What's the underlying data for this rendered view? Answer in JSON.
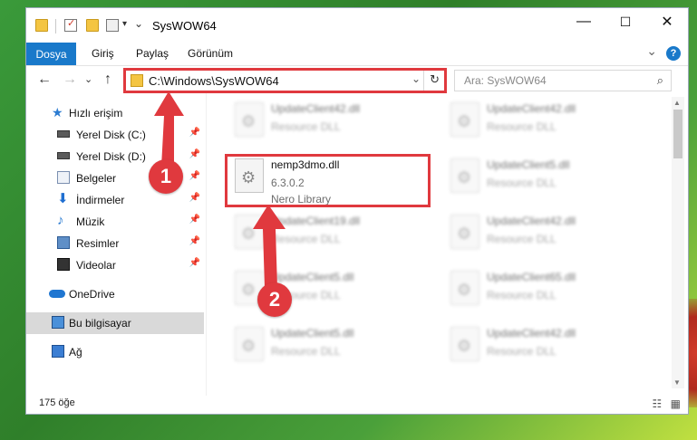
{
  "window": {
    "title": "SysWOW64",
    "controls": {
      "minimize": "—",
      "maximize": "☐",
      "close": "✕"
    }
  },
  "ribbon": {
    "tabs": [
      "Dosya",
      "Giriş",
      "Paylaş",
      "Görünüm"
    ],
    "expand_glyph": "⌄",
    "help_glyph": "?"
  },
  "navigation": {
    "back": "←",
    "forward": "→",
    "recent": "⌄",
    "up": "↑",
    "address": "C:\\Windows\\SysWOW64",
    "address_chevron": "⌄",
    "refresh": "↻",
    "search_placeholder": "Ara: SysWOW64",
    "search_glyph": "⌕"
  },
  "sidebar": {
    "pin_glyph": "📌",
    "items": [
      {
        "label": "Hızlı erişim",
        "icon": "star-icon",
        "pinned": false
      },
      {
        "label": "Yerel Disk (C:)",
        "icon": "drive-icon",
        "pinned": true
      },
      {
        "label": "Yerel Disk (D:)",
        "icon": "drive-icon",
        "pinned": true
      },
      {
        "label": "Belgeler",
        "icon": "documents-icon",
        "pinned": true
      },
      {
        "label": "İndirmeler",
        "icon": "download-icon",
        "pinned": true
      },
      {
        "label": "Müzik",
        "icon": "music-icon",
        "pinned": true
      },
      {
        "label": "Resimler",
        "icon": "pictures-icon",
        "pinned": true
      },
      {
        "label": "Videolar",
        "icon": "videos-icon",
        "pinned": true
      },
      {
        "label": "OneDrive",
        "icon": "onedrive-icon",
        "pinned": false
      },
      {
        "label": "Bu bilgisayar",
        "icon": "this-pc-icon",
        "pinned": false,
        "selected": true
      },
      {
        "label": "Ağ",
        "icon": "network-icon",
        "pinned": false
      }
    ]
  },
  "files": [
    {
      "name": "UpdateClient42.dll",
      "desc": "Resource DLL",
      "blurred": true
    },
    {
      "name": "UpdateClient42.dll",
      "desc": "Resource DLL",
      "blurred": true
    },
    {
      "name": "nemp3dmo.dll",
      "version": "6.3.0.2",
      "desc": "Nero Library",
      "blurred": false,
      "highlighted": true
    },
    {
      "name": "UpdateClient5.dll",
      "desc": "Resource DLL",
      "blurred": true
    },
    {
      "name": "UpdateClient19.dll",
      "desc": "Resource DLL",
      "blurred": true
    },
    {
      "name": "UpdateClient42.dll",
      "desc": "Resource DLL",
      "blurred": true
    },
    {
      "name": "UpdateClient5.dll",
      "desc": "Resource DLL",
      "blurred": true
    },
    {
      "name": "UpdateClient65.dll",
      "desc": "Resource DLL",
      "blurred": true
    },
    {
      "name": "UpdateClient5.dll",
      "desc": "Resource DLL",
      "blurred": true
    },
    {
      "name": "UpdateClient42.dll",
      "desc": "Resource DLL",
      "blurred": true
    }
  ],
  "status": {
    "count": "175 öğe",
    "view_details": "☷",
    "view_tiles": "▦"
  },
  "annotations": [
    {
      "number": "1",
      "color": "#e0393e"
    },
    {
      "number": "2",
      "color": "#e0393e"
    }
  ]
}
